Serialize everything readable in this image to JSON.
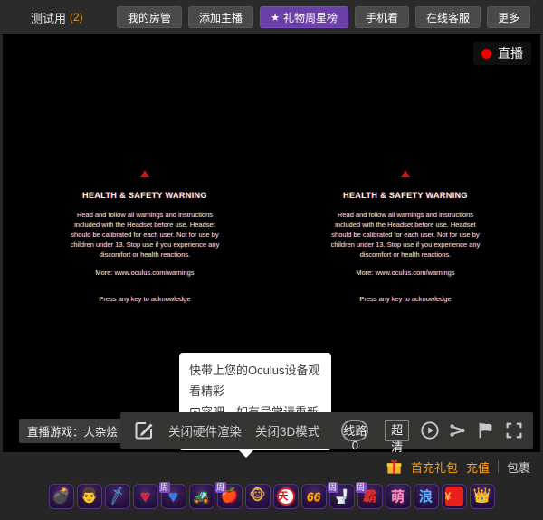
{
  "topbar": {
    "room_title": "测试用",
    "room_count": "(2)",
    "buttons": [
      {
        "label": "我的房管"
      },
      {
        "label": "添加主播"
      },
      {
        "label": "礼物周星榜",
        "icon": "star"
      },
      {
        "label": "手机看"
      },
      {
        "label": "在线客服"
      },
      {
        "label": "更多"
      }
    ]
  },
  "stage": {
    "live_badge": "直播",
    "warning": {
      "title": "HEALTH & SAFETY WARNING",
      "body_lines": [
        "Read and follow all warnings and instructions",
        "included with the Headset before use. Headset",
        "should be calibrated for each user. Not for use by",
        "children under 13. Stop use if you experience any",
        "discomfort or health reactions."
      ],
      "more": "More: www.oculus.com/warnings",
      "acknowledge": "Press any key to acknowledge"
    },
    "tooltip": {
      "line1": "快带上您的Oculus设备观看精彩",
      "line2": "内容吧。如有异常请重新尝试"
    },
    "game_label": "直播游戏：大杂烩",
    "controls": {
      "hw_render_label": "关闭硬件渲染",
      "mode_3d_label": "关闭3D模式",
      "line_label": "线路0",
      "quality_label": "超清"
    }
  },
  "bottom": {
    "first_recharge_label": "首充礼包",
    "recharge_label": "充值",
    "package_label": "包裹",
    "gifts": [
      {
        "name": "bomb-face",
        "glyph": "💣",
        "badge": ""
      },
      {
        "name": "man-portrait",
        "glyph": "👨",
        "badge": ""
      },
      {
        "name": "blue-sword",
        "glyph": "🗡",
        "badge": ""
      },
      {
        "name": "red-heart",
        "glyph": "♥",
        "badge": ""
      },
      {
        "name": "blue-heart",
        "glyph": "♥",
        "badge": "周"
      },
      {
        "name": "excavator",
        "glyph": "🚜",
        "badge": ""
      },
      {
        "name": "red-apple",
        "glyph": "🍎",
        "badge": "周"
      },
      {
        "name": "monkey-face",
        "glyph": "🐵",
        "badge": ""
      },
      {
        "name": "tianzi-seal",
        "glyph": "天",
        "badge": ""
      },
      {
        "name": "flame-66",
        "glyph": "66",
        "badge": ""
      },
      {
        "name": "toilet",
        "glyph": "🚽",
        "badge": "周"
      },
      {
        "name": "ba-banner",
        "glyph": "霸",
        "badge": "周"
      },
      {
        "name": "meng-banner",
        "glyph": "萌",
        "badge": ""
      },
      {
        "name": "lang-banner",
        "glyph": "浪",
        "badge": ""
      },
      {
        "name": "red-packet",
        "glyph": "¥",
        "badge": ""
      },
      {
        "name": "gold-crown",
        "glyph": "👑",
        "badge": ""
      }
    ]
  },
  "colors": {
    "accent_purple": "#6b3fa8",
    "accent_orange": "#ffa21a",
    "live_red": "#f20000",
    "topbar_bg": "#2b2b2b",
    "panel_bg": "#262626",
    "video_bg": "#000000"
  }
}
